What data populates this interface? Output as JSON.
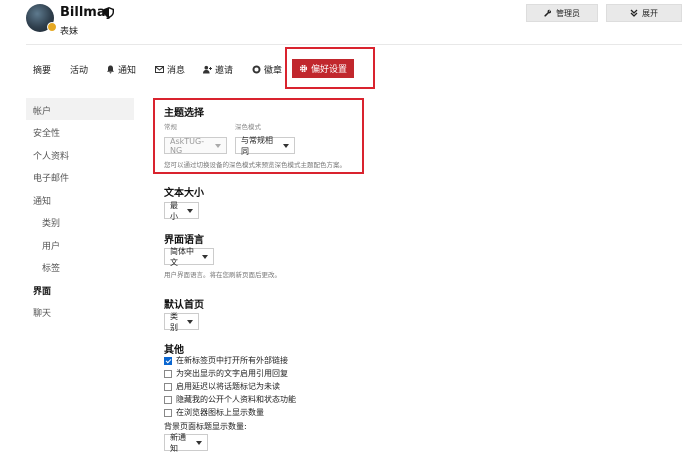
{
  "header": {
    "username": "Billmay",
    "subtitle": "表妹",
    "admin_button": "管理员",
    "expand_button": "展开"
  },
  "tabs": [
    {
      "label": "摘要"
    },
    {
      "label": "活动"
    },
    {
      "label": "通知"
    },
    {
      "label": "消息"
    },
    {
      "label": "邀请"
    },
    {
      "label": "徽章"
    },
    {
      "label": "偏好设置",
      "active": true
    }
  ],
  "sidebar": {
    "items": [
      {
        "label": "帐户"
      },
      {
        "label": "安全性"
      },
      {
        "label": "个人资料"
      },
      {
        "label": "电子邮件"
      },
      {
        "label": "通知"
      },
      {
        "label": "类别"
      },
      {
        "label": "用户"
      },
      {
        "label": "标签"
      },
      {
        "label": "界面",
        "active": true
      },
      {
        "label": "聊天"
      }
    ]
  },
  "theme": {
    "title": "主题选择",
    "regular_label": "常规",
    "dark_label": "深色模式",
    "regular_value": "AskTUG-NG",
    "dark_value": "与常规相同",
    "hint": "您可以通过切换设备的深色模式来预览深色模式主题配色方案。"
  },
  "text_size": {
    "title": "文本大小",
    "value": "最小"
  },
  "language": {
    "title": "界面语言",
    "value": "简体中文",
    "hint": "用户界面语言。将在您刷新页面后更改。"
  },
  "homepage": {
    "title": "默认首页",
    "value": "类别"
  },
  "other": {
    "title": "其他",
    "options": [
      {
        "label": "在新标签页中打开所有外部链接",
        "checked": true
      },
      {
        "label": "为突出显示的文字启用引用回复",
        "checked": false
      },
      {
        "label": "启用延迟以将话题标记为未读",
        "checked": false
      },
      {
        "label": "隐藏我的公开个人资料和状态功能",
        "checked": false
      },
      {
        "label": "在浏览器图标上显示数量",
        "checked": false
      }
    ],
    "bg_count_label": "背景页面标题显示数量:",
    "bg_count_value": "新通知"
  },
  "colors": {
    "accent": "#c1272d",
    "highlight": "#d9232e",
    "checkbox": "#0a66d0"
  }
}
